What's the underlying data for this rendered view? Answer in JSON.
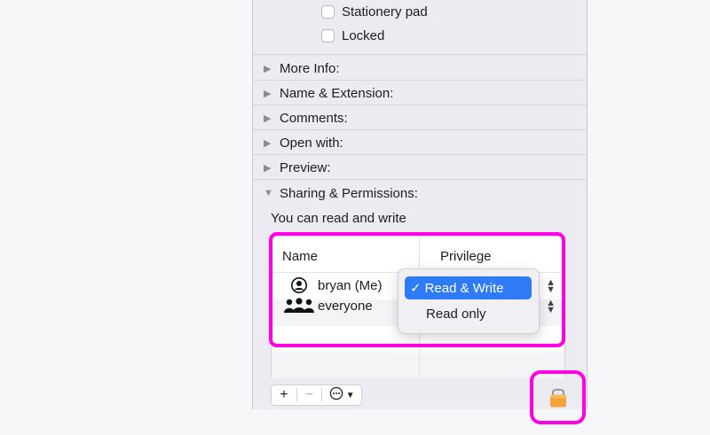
{
  "checkboxes": [
    {
      "label": "Stationery pad",
      "checked": false
    },
    {
      "label": "Locked",
      "checked": false
    }
  ],
  "sections": [
    {
      "label": "More Info:",
      "expanded": false
    },
    {
      "label": "Name & Extension:",
      "expanded": false
    },
    {
      "label": "Comments:",
      "expanded": false
    },
    {
      "label": "Open with:",
      "expanded": false
    },
    {
      "label": "Preview:",
      "expanded": false
    },
    {
      "label": "Sharing & Permissions:",
      "expanded": true
    }
  ],
  "sharing": {
    "note": "You can read and write",
    "columns": {
      "name": "Name",
      "privilege": "Privilege"
    },
    "rows": [
      {
        "name": "bryan (Me)",
        "icon": "person-icon"
      },
      {
        "name": "everyone",
        "icon": "group-icon"
      }
    ]
  },
  "privilege_menu": {
    "options": [
      "Read & Write",
      "Read only"
    ],
    "selected": "Read & Write",
    "checkmark": "✓"
  },
  "toolbar": {
    "add": "+",
    "remove": "−",
    "more": "⋯"
  },
  "colors": {
    "highlight": "#ff00e5",
    "selection": "#2f7bf6",
    "lock": "#f2a33a"
  }
}
